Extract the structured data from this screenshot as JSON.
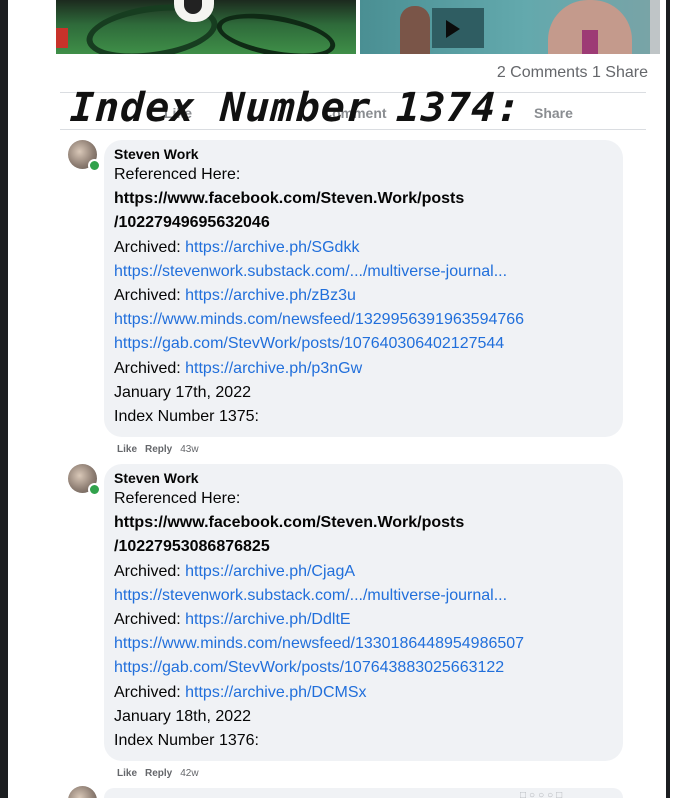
{
  "post": {
    "stats": "2 Comments 1 Share",
    "actions": {
      "like": "Like",
      "comment": "Comment",
      "share": "Share"
    }
  },
  "overlay": {
    "title": "Index Number 1374:"
  },
  "comments": [
    {
      "author": "Steven Work",
      "lines": {
        "l1": "Referenced Here:",
        "l2": "https://www.facebook.com/Steven.Work/posts",
        "l3": "/10227949695632046",
        "l4_label": "Archived: ",
        "l4_link": "https://archive.ph/SGdkk",
        "l5": "https://stevenwork.substack.com/.../multiverse-journal...",
        "l6_label": "Archived: ",
        "l6_link": "https://archive.ph/zBz3u",
        "l7": "https://www.minds.com/newsfeed/1329956391963594766",
        "l8": "https://gab.com/StevWork/posts/107640306402127544",
        "l9_label": "Archived: ",
        "l9_link": "https://archive.ph/p3nGw",
        "l10": "January 17th, 2022",
        "l11": "Index Number 1375:"
      },
      "meta": {
        "like": "Like",
        "reply": "Reply",
        "age": "43w"
      }
    },
    {
      "author": "Steven Work",
      "lines": {
        "l1": "Referenced Here:",
        "l2": "https://www.facebook.com/Steven.Work/posts",
        "l3": "/10227953086876825",
        "l4_label": "Archived: ",
        "l4_link": "https://archive.ph/CjagA",
        "l5": "https://stevenwork.substack.com/.../multiverse-journal...",
        "l6_label": "Archived: ",
        "l6_link": "https://archive.ph/DdltE",
        "l7": "https://www.minds.com/newsfeed/1330186448954986507",
        "l8": "https://gab.com/StevWork/posts/107643883025663122",
        "l9_label": "Archived: ",
        "l9_link": "https://archive.ph/DCMSx",
        "l10": "January 18th, 2022",
        "l11": "Index Number 1376:"
      },
      "meta": {
        "like": "Like",
        "reply": "Reply",
        "age": "42w"
      }
    }
  ],
  "icons": {
    "next_comment_reactions": "reaction-icons"
  }
}
